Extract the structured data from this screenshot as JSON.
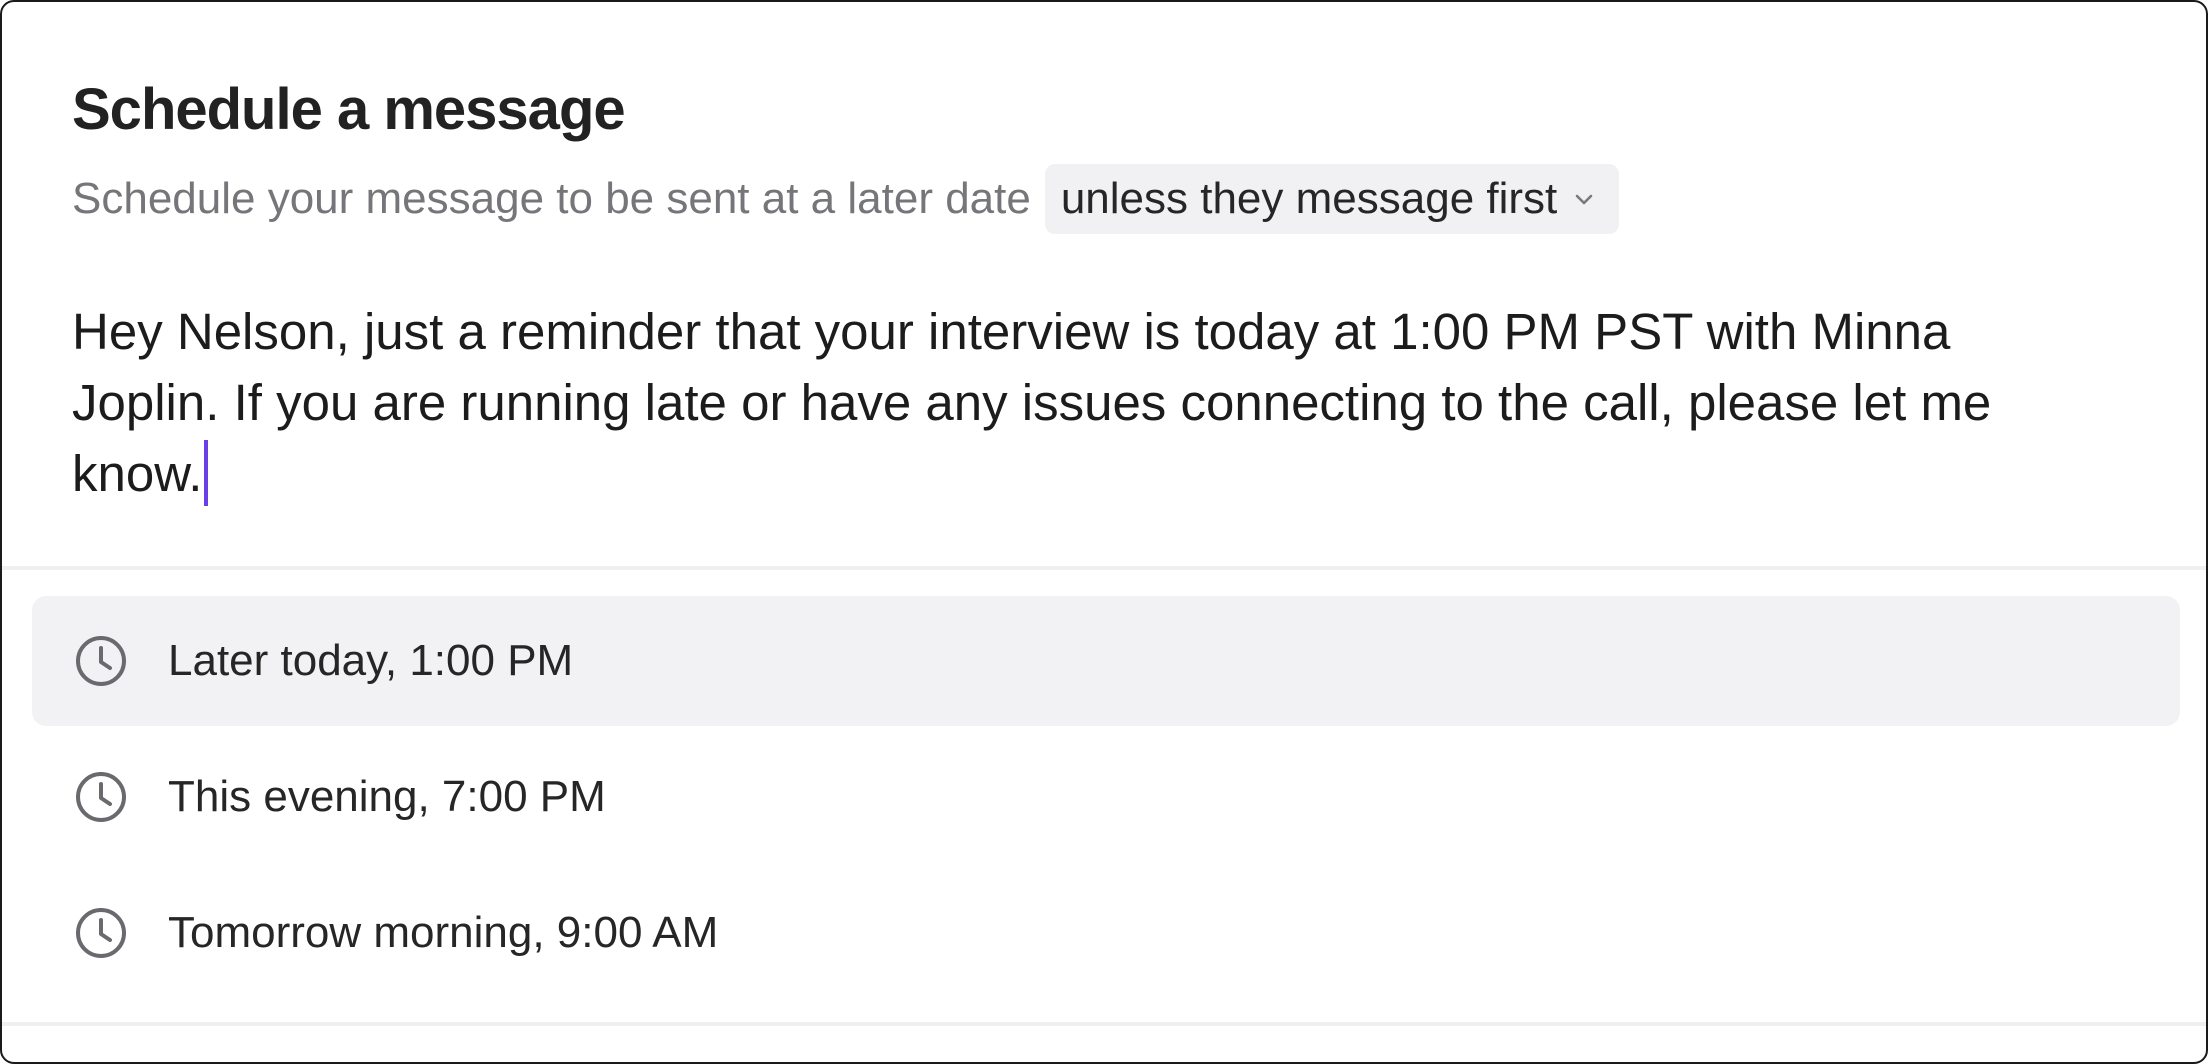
{
  "dialog": {
    "title": "Schedule a message",
    "subtitle": "Schedule your message to be sent at a later date",
    "condition": {
      "selected": "unless they message first",
      "icon": "chevron-down-icon"
    }
  },
  "message": {
    "text": "Hey Nelson, just a reminder that your interview is today at 1:00 PM PST with Minna Joplin. If you are running late or have any issues connecting to the call, please let me know."
  },
  "schedule_options": [
    {
      "label": "Later today, 1:00 PM",
      "icon": "clock-icon",
      "highlighted": true
    },
    {
      "label": "This evening, 7:00 PM",
      "icon": "clock-icon",
      "highlighted": false
    },
    {
      "label": "Tomorrow morning, 9:00 AM",
      "icon": "clock-icon",
      "highlighted": false
    }
  ],
  "colors": {
    "caret": "#6b3fe6",
    "highlight_bg": "#f2f2f4",
    "muted_text": "#76767a"
  }
}
